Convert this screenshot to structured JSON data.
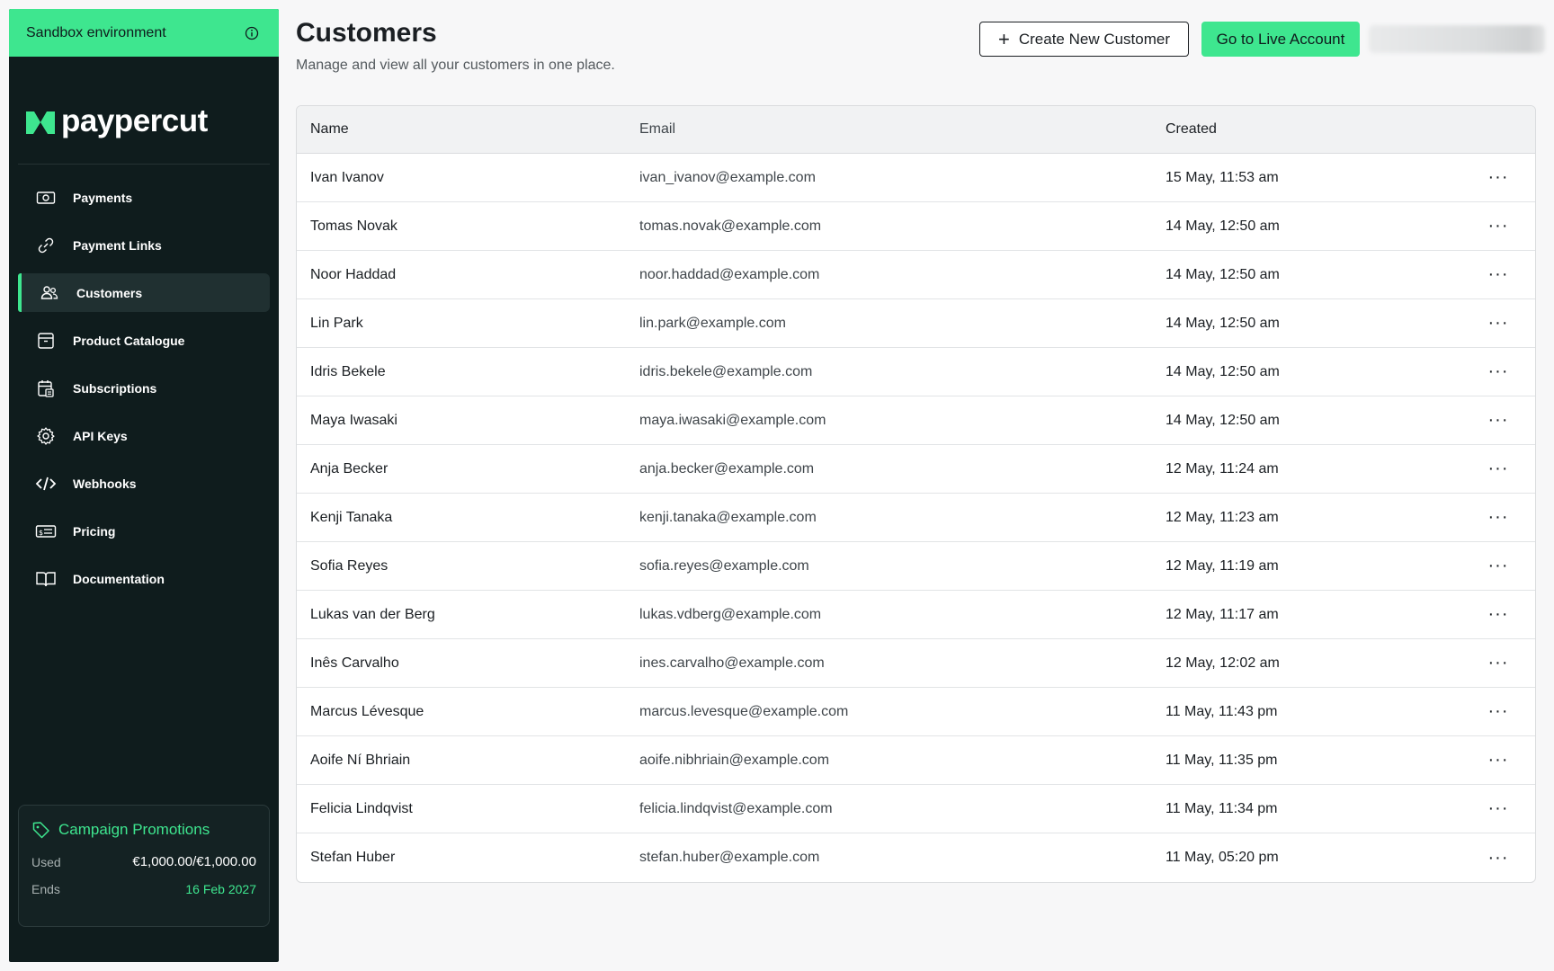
{
  "sidebar": {
    "env_label": "Sandbox environment",
    "brand": "paypercut",
    "items": [
      {
        "label": "Payments",
        "icon": "payments-icon"
      },
      {
        "label": "Payment Links",
        "icon": "link-icon"
      },
      {
        "label": "Customers",
        "icon": "users-icon"
      },
      {
        "label": "Product Catalogue",
        "icon": "box-icon"
      },
      {
        "label": "Subscriptions",
        "icon": "calendar-icon"
      },
      {
        "label": "API Keys",
        "icon": "gear-icon"
      },
      {
        "label": "Webhooks",
        "icon": "code-icon"
      },
      {
        "label": "Pricing",
        "icon": "price-icon"
      },
      {
        "label": "Documentation",
        "icon": "book-icon"
      }
    ],
    "active": "Customers",
    "campaign": {
      "title": "Campaign Promotions",
      "used_label": "Used",
      "used_value": "€1,000.00/€1,000.00",
      "ends_label": "Ends",
      "ends_value": "16 Feb 2027"
    }
  },
  "header": {
    "title": "Customers",
    "subtitle": "Manage and view all your customers in one place.",
    "create_button": "Create New Customer",
    "live_button": "Go to Live Account"
  },
  "colors": {
    "accent": "#3ee68f",
    "sidebar_bg": "#0f1c1d"
  },
  "table": {
    "columns": [
      "Name",
      "Email",
      "Created"
    ],
    "rows": [
      {
        "name": "Ivan Ivanov",
        "email": "ivan_ivanov@example.com",
        "created": "15 May, 11:53 am"
      },
      {
        "name": "Tomas Novak",
        "email": "tomas.novak@example.com",
        "created": "14 May, 12:50 am"
      },
      {
        "name": "Noor Haddad",
        "email": "noor.haddad@example.com",
        "created": "14 May, 12:50 am"
      },
      {
        "name": "Lin Park",
        "email": "lin.park@example.com",
        "created": "14 May, 12:50 am"
      },
      {
        "name": "Idris Bekele",
        "email": "idris.bekele@example.com",
        "created": "14 May, 12:50 am"
      },
      {
        "name": "Maya Iwasaki",
        "email": "maya.iwasaki@example.com",
        "created": "14 May, 12:50 am"
      },
      {
        "name": "Anja Becker",
        "email": "anja.becker@example.com",
        "created": "12 May, 11:24 am"
      },
      {
        "name": "Kenji Tanaka",
        "email": "kenji.tanaka@example.com",
        "created": "12 May, 11:23 am"
      },
      {
        "name": "Sofia Reyes",
        "email": "sofia.reyes@example.com",
        "created": "12 May, 11:19 am"
      },
      {
        "name": "Lukas van der Berg",
        "email": "lukas.vdberg@example.com",
        "created": "12 May, 11:17 am"
      },
      {
        "name": "Inês Carvalho",
        "email": "ines.carvalho@example.com",
        "created": "12 May, 12:02 am"
      },
      {
        "name": "Marcus Lévesque",
        "email": "marcus.levesque@example.com",
        "created": "11 May, 11:43 pm"
      },
      {
        "name": "Aoife Ní Bhriain",
        "email": "aoife.nibhriain@example.com",
        "created": "11 May, 11:35 pm"
      },
      {
        "name": "Felicia Lindqvist",
        "email": "felicia.lindqvist@example.com",
        "created": "11 May, 11:34 pm"
      },
      {
        "name": "Stefan Huber",
        "email": "stefan.huber@example.com",
        "created": "11 May, 05:20 pm"
      }
    ]
  }
}
